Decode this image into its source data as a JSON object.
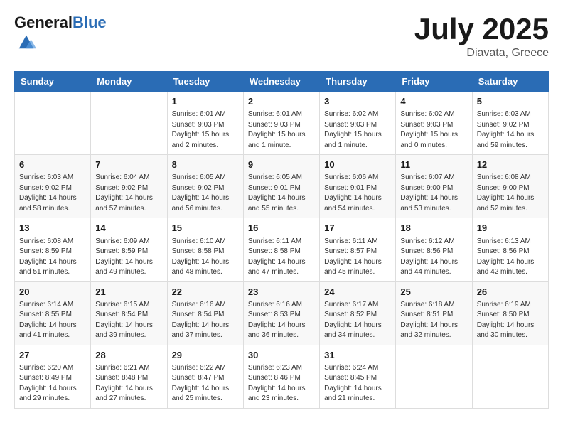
{
  "header": {
    "logo_general": "General",
    "logo_blue": "Blue",
    "month": "July 2025",
    "location": "Diavata, Greece"
  },
  "weekdays": [
    "Sunday",
    "Monday",
    "Tuesday",
    "Wednesday",
    "Thursday",
    "Friday",
    "Saturday"
  ],
  "weeks": [
    [
      {
        "day": "",
        "sunrise": "",
        "sunset": "",
        "daylight": ""
      },
      {
        "day": "",
        "sunrise": "",
        "sunset": "",
        "daylight": ""
      },
      {
        "day": "1",
        "sunrise": "Sunrise: 6:01 AM",
        "sunset": "Sunset: 9:03 PM",
        "daylight": "Daylight: 15 hours and 2 minutes."
      },
      {
        "day": "2",
        "sunrise": "Sunrise: 6:01 AM",
        "sunset": "Sunset: 9:03 PM",
        "daylight": "Daylight: 15 hours and 1 minute."
      },
      {
        "day": "3",
        "sunrise": "Sunrise: 6:02 AM",
        "sunset": "Sunset: 9:03 PM",
        "daylight": "Daylight: 15 hours and 1 minute."
      },
      {
        "day": "4",
        "sunrise": "Sunrise: 6:02 AM",
        "sunset": "Sunset: 9:03 PM",
        "daylight": "Daylight: 15 hours and 0 minutes."
      },
      {
        "day": "5",
        "sunrise": "Sunrise: 6:03 AM",
        "sunset": "Sunset: 9:02 PM",
        "daylight": "Daylight: 14 hours and 59 minutes."
      }
    ],
    [
      {
        "day": "6",
        "sunrise": "Sunrise: 6:03 AM",
        "sunset": "Sunset: 9:02 PM",
        "daylight": "Daylight: 14 hours and 58 minutes."
      },
      {
        "day": "7",
        "sunrise": "Sunrise: 6:04 AM",
        "sunset": "Sunset: 9:02 PM",
        "daylight": "Daylight: 14 hours and 57 minutes."
      },
      {
        "day": "8",
        "sunrise": "Sunrise: 6:05 AM",
        "sunset": "Sunset: 9:02 PM",
        "daylight": "Daylight: 14 hours and 56 minutes."
      },
      {
        "day": "9",
        "sunrise": "Sunrise: 6:05 AM",
        "sunset": "Sunset: 9:01 PM",
        "daylight": "Daylight: 14 hours and 55 minutes."
      },
      {
        "day": "10",
        "sunrise": "Sunrise: 6:06 AM",
        "sunset": "Sunset: 9:01 PM",
        "daylight": "Daylight: 14 hours and 54 minutes."
      },
      {
        "day": "11",
        "sunrise": "Sunrise: 6:07 AM",
        "sunset": "Sunset: 9:00 PM",
        "daylight": "Daylight: 14 hours and 53 minutes."
      },
      {
        "day": "12",
        "sunrise": "Sunrise: 6:08 AM",
        "sunset": "Sunset: 9:00 PM",
        "daylight": "Daylight: 14 hours and 52 minutes."
      }
    ],
    [
      {
        "day": "13",
        "sunrise": "Sunrise: 6:08 AM",
        "sunset": "Sunset: 8:59 PM",
        "daylight": "Daylight: 14 hours and 51 minutes."
      },
      {
        "day": "14",
        "sunrise": "Sunrise: 6:09 AM",
        "sunset": "Sunset: 8:59 PM",
        "daylight": "Daylight: 14 hours and 49 minutes."
      },
      {
        "day": "15",
        "sunrise": "Sunrise: 6:10 AM",
        "sunset": "Sunset: 8:58 PM",
        "daylight": "Daylight: 14 hours and 48 minutes."
      },
      {
        "day": "16",
        "sunrise": "Sunrise: 6:11 AM",
        "sunset": "Sunset: 8:58 PM",
        "daylight": "Daylight: 14 hours and 47 minutes."
      },
      {
        "day": "17",
        "sunrise": "Sunrise: 6:11 AM",
        "sunset": "Sunset: 8:57 PM",
        "daylight": "Daylight: 14 hours and 45 minutes."
      },
      {
        "day": "18",
        "sunrise": "Sunrise: 6:12 AM",
        "sunset": "Sunset: 8:56 PM",
        "daylight": "Daylight: 14 hours and 44 minutes."
      },
      {
        "day": "19",
        "sunrise": "Sunrise: 6:13 AM",
        "sunset": "Sunset: 8:56 PM",
        "daylight": "Daylight: 14 hours and 42 minutes."
      }
    ],
    [
      {
        "day": "20",
        "sunrise": "Sunrise: 6:14 AM",
        "sunset": "Sunset: 8:55 PM",
        "daylight": "Daylight: 14 hours and 41 minutes."
      },
      {
        "day": "21",
        "sunrise": "Sunrise: 6:15 AM",
        "sunset": "Sunset: 8:54 PM",
        "daylight": "Daylight: 14 hours and 39 minutes."
      },
      {
        "day": "22",
        "sunrise": "Sunrise: 6:16 AM",
        "sunset": "Sunset: 8:54 PM",
        "daylight": "Daylight: 14 hours and 37 minutes."
      },
      {
        "day": "23",
        "sunrise": "Sunrise: 6:16 AM",
        "sunset": "Sunset: 8:53 PM",
        "daylight": "Daylight: 14 hours and 36 minutes."
      },
      {
        "day": "24",
        "sunrise": "Sunrise: 6:17 AM",
        "sunset": "Sunset: 8:52 PM",
        "daylight": "Daylight: 14 hours and 34 minutes."
      },
      {
        "day": "25",
        "sunrise": "Sunrise: 6:18 AM",
        "sunset": "Sunset: 8:51 PM",
        "daylight": "Daylight: 14 hours and 32 minutes."
      },
      {
        "day": "26",
        "sunrise": "Sunrise: 6:19 AM",
        "sunset": "Sunset: 8:50 PM",
        "daylight": "Daylight: 14 hours and 30 minutes."
      }
    ],
    [
      {
        "day": "27",
        "sunrise": "Sunrise: 6:20 AM",
        "sunset": "Sunset: 8:49 PM",
        "daylight": "Daylight: 14 hours and 29 minutes."
      },
      {
        "day": "28",
        "sunrise": "Sunrise: 6:21 AM",
        "sunset": "Sunset: 8:48 PM",
        "daylight": "Daylight: 14 hours and 27 minutes."
      },
      {
        "day": "29",
        "sunrise": "Sunrise: 6:22 AM",
        "sunset": "Sunset: 8:47 PM",
        "daylight": "Daylight: 14 hours and 25 minutes."
      },
      {
        "day": "30",
        "sunrise": "Sunrise: 6:23 AM",
        "sunset": "Sunset: 8:46 PM",
        "daylight": "Daylight: 14 hours and 23 minutes."
      },
      {
        "day": "31",
        "sunrise": "Sunrise: 6:24 AM",
        "sunset": "Sunset: 8:45 PM",
        "daylight": "Daylight: 14 hours and 21 minutes."
      },
      {
        "day": "",
        "sunrise": "",
        "sunset": "",
        "daylight": ""
      },
      {
        "day": "",
        "sunrise": "",
        "sunset": "",
        "daylight": ""
      }
    ]
  ]
}
